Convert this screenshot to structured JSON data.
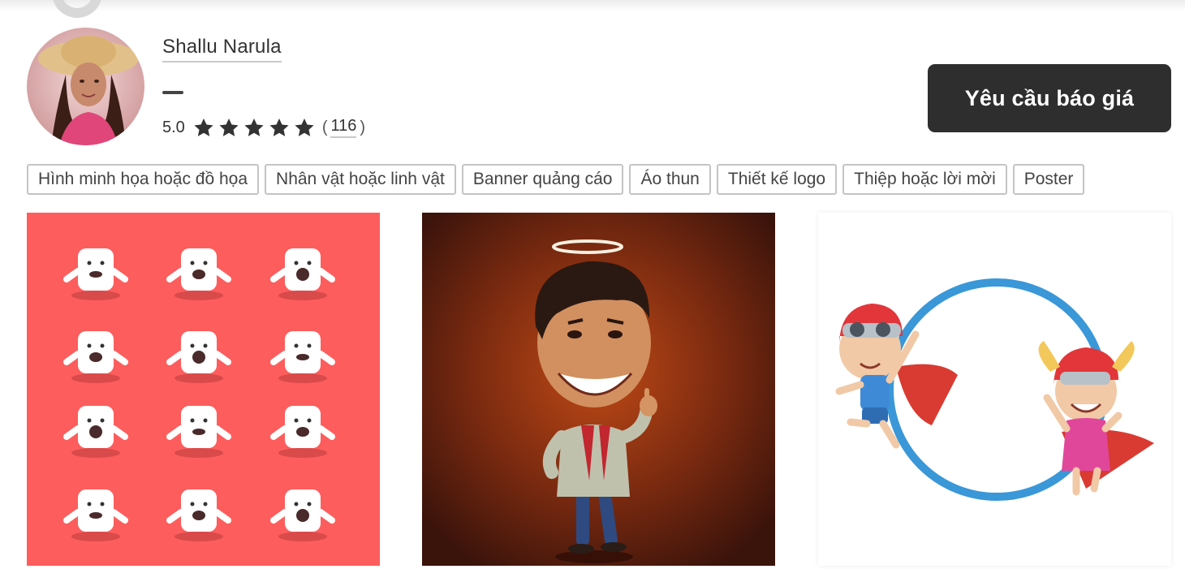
{
  "profile": {
    "name": "Shallu Narula",
    "rating": "5.0",
    "stars": 5,
    "review_count": "116",
    "paren_open": "(",
    "paren_close": ")"
  },
  "actions": {
    "quote_button_label": "Yêu cầu báo giá"
  },
  "tags": [
    "Hình minh họa hoặc đồ họa",
    "Nhân vật hoặc linh vật",
    "Banner quảng cáo",
    "Áo thun",
    "Thiết kế logo",
    "Thiệp hoặc lời mời",
    "Poster"
  ],
  "portfolio": [
    {
      "description_icon": "mascot-sticker-sheet-image"
    },
    {
      "description_icon": "caricature-portrait-image"
    },
    {
      "description_icon": "superhero-kids-image"
    }
  ],
  "colors": {
    "button_bg": "#2e2e2e",
    "card1_bg": "#fd5d5d",
    "card2_bg": "#6e2a12",
    "ring": "#3a97d8"
  }
}
